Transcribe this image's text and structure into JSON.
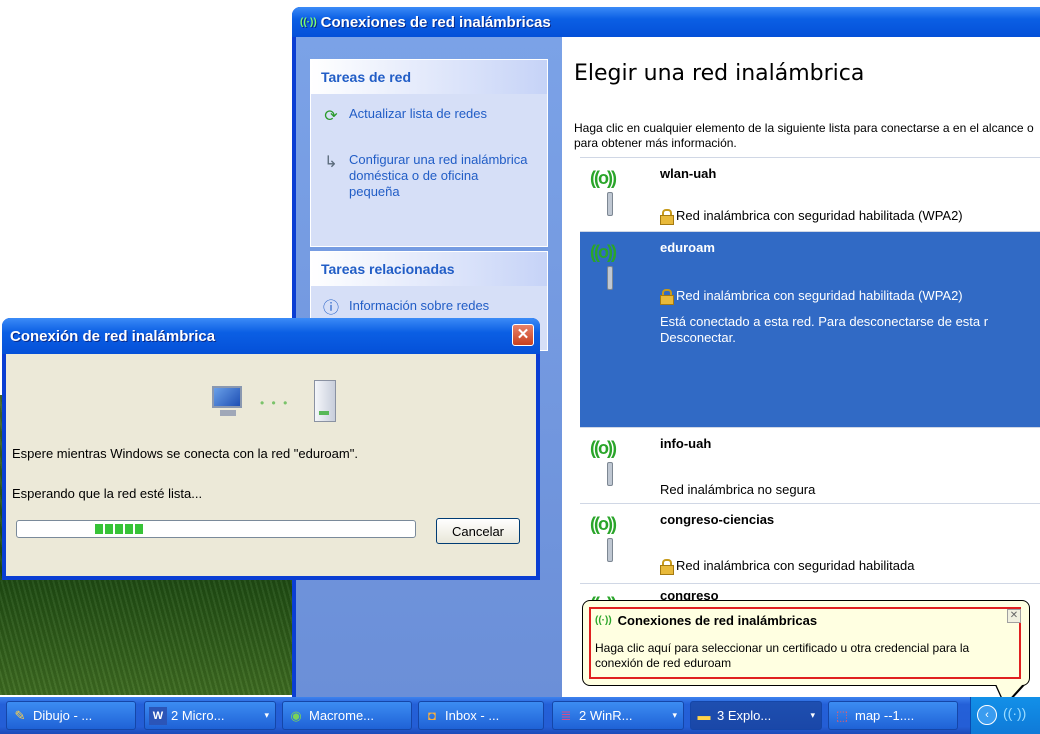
{
  "main_window": {
    "title": "Conexiones de red inalámbricas",
    "tasks_header": "Tareas de red",
    "task_refresh": "Actualizar lista de redes",
    "task_configure": "Configurar una red inalámbrica doméstica o de oficina pequeña",
    "related_header": "Tareas relacionadas",
    "related_info": "Información sobre redes",
    "heading": "Elegir una red inalámbrica",
    "intro": "Haga clic en cualquier elemento de la siguiente lista para conectarse a en el alcance o para obtener más información.",
    "networks": [
      {
        "name": "wlan-uah",
        "security": "Red inalámbrica con seguridad habilitada (WPA2)",
        "secure": true
      },
      {
        "name": "eduroam",
        "security": "Red inalámbrica con seguridad habilitada (WPA2)",
        "secure": true,
        "message": "Está conectado a esta red. Para desconectarse de esta r Desconectar."
      },
      {
        "name": "info-uah",
        "security": "Red inalámbrica no segura",
        "secure": false
      },
      {
        "name": "congreso-ciencias",
        "security": "Red inalámbrica con seguridad habilitada",
        "secure": true
      },
      {
        "name": "congreso",
        "security": "",
        "secure": false
      }
    ]
  },
  "dialog": {
    "title": "Conexión de red inalámbrica",
    "wait_text": "Espere mientras Windows se conecta con la red \"eduroam\".",
    "status_text": "Esperando que la red esté lista...",
    "cancel_label": "Cancelar"
  },
  "balloon": {
    "title": "Conexiones de red inalámbricas",
    "text": "Haga clic aquí para seleccionar un certificado u otra credencial para la conexión de red eduroam"
  },
  "taskbar": {
    "items": [
      {
        "label": "Dibujo - ...",
        "icon": "paint-icon"
      },
      {
        "label": "2 Micro...",
        "icon": "word-icon"
      },
      {
        "label": "Macrome...",
        "icon": "dreamweaver-icon"
      },
      {
        "label": "Inbox - ...",
        "icon": "mail-icon"
      },
      {
        "label": "2 WinR...",
        "icon": "winrar-icon"
      },
      {
        "label": "3 Explo...",
        "icon": "folder-icon"
      },
      {
        "label": "map --1....",
        "icon": "pdf-icon"
      }
    ]
  },
  "colors": {
    "xp_blue": "#0a3ed3",
    "selection": "#316ac5",
    "progress": "#37c337",
    "balloon_highlight": "#e02020"
  }
}
